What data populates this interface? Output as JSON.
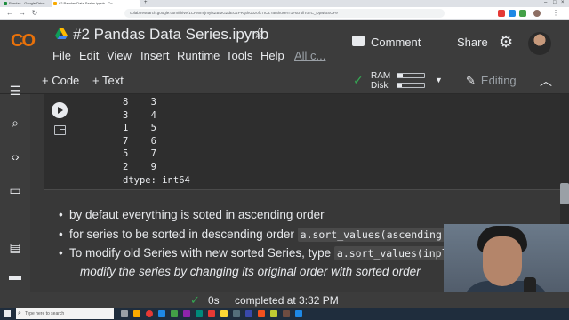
{
  "browser": {
    "tabs": [
      {
        "title": "Pandas - Google Drive",
        "active": false
      },
      {
        "title": "#2 Pandas Data Series.ipynb - Co...",
        "active": true
      }
    ],
    "url": "colab.research.google.com/drive/1CRMrmjmyfsZBMGZdEOzPRgthU0z0fc7ICZ?authuser=1#scrollTo=C_DpwfoSOFe"
  },
  "colab": {
    "logo": "CO",
    "notebook_title": "#2 Pandas Data Series.ipynb",
    "menu": [
      "File",
      "Edit",
      "View",
      "Insert",
      "Runtime",
      "Tools",
      "Help",
      "All c..."
    ],
    "comment_label": "Comment",
    "share_label": "Share"
  },
  "toolbar": {
    "add_code": "+ Code",
    "add_text": "+ Text",
    "ram_label": "RAM",
    "disk_label": "Disk",
    "ram_fraction": 0.2,
    "disk_fraction": 0.15,
    "editing_label": "Editing"
  },
  "output": {
    "rows": [
      "8    3",
      "3    4",
      "1    5",
      "7    6",
      "5    7",
      "2    9"
    ],
    "dtype": "dtype: int64"
  },
  "text_cell": {
    "bullet1": "by defaut everything is soted in ascending order",
    "bullet2_text": "for series to be sorted in descending order ",
    "bullet2_code": "a.sort_values(ascending",
    "bullet3_text": "To modify old Series with new sorted Series, type ",
    "bullet3_code": "a.sort_values(inpl",
    "bullet3_cont": "modify the series by changing its original order with sorted order"
  },
  "status": {
    "duration": "0s",
    "completed": "completed at 3:32 PM"
  },
  "taskbar": {
    "search_placeholder": "Type here to search"
  },
  "colors": {
    "background": "#383838",
    "header": "#3c3c3c",
    "logo_yellow": "#f9ab00",
    "logo_orange": "#e8710a",
    "success_green": "#34a853"
  }
}
